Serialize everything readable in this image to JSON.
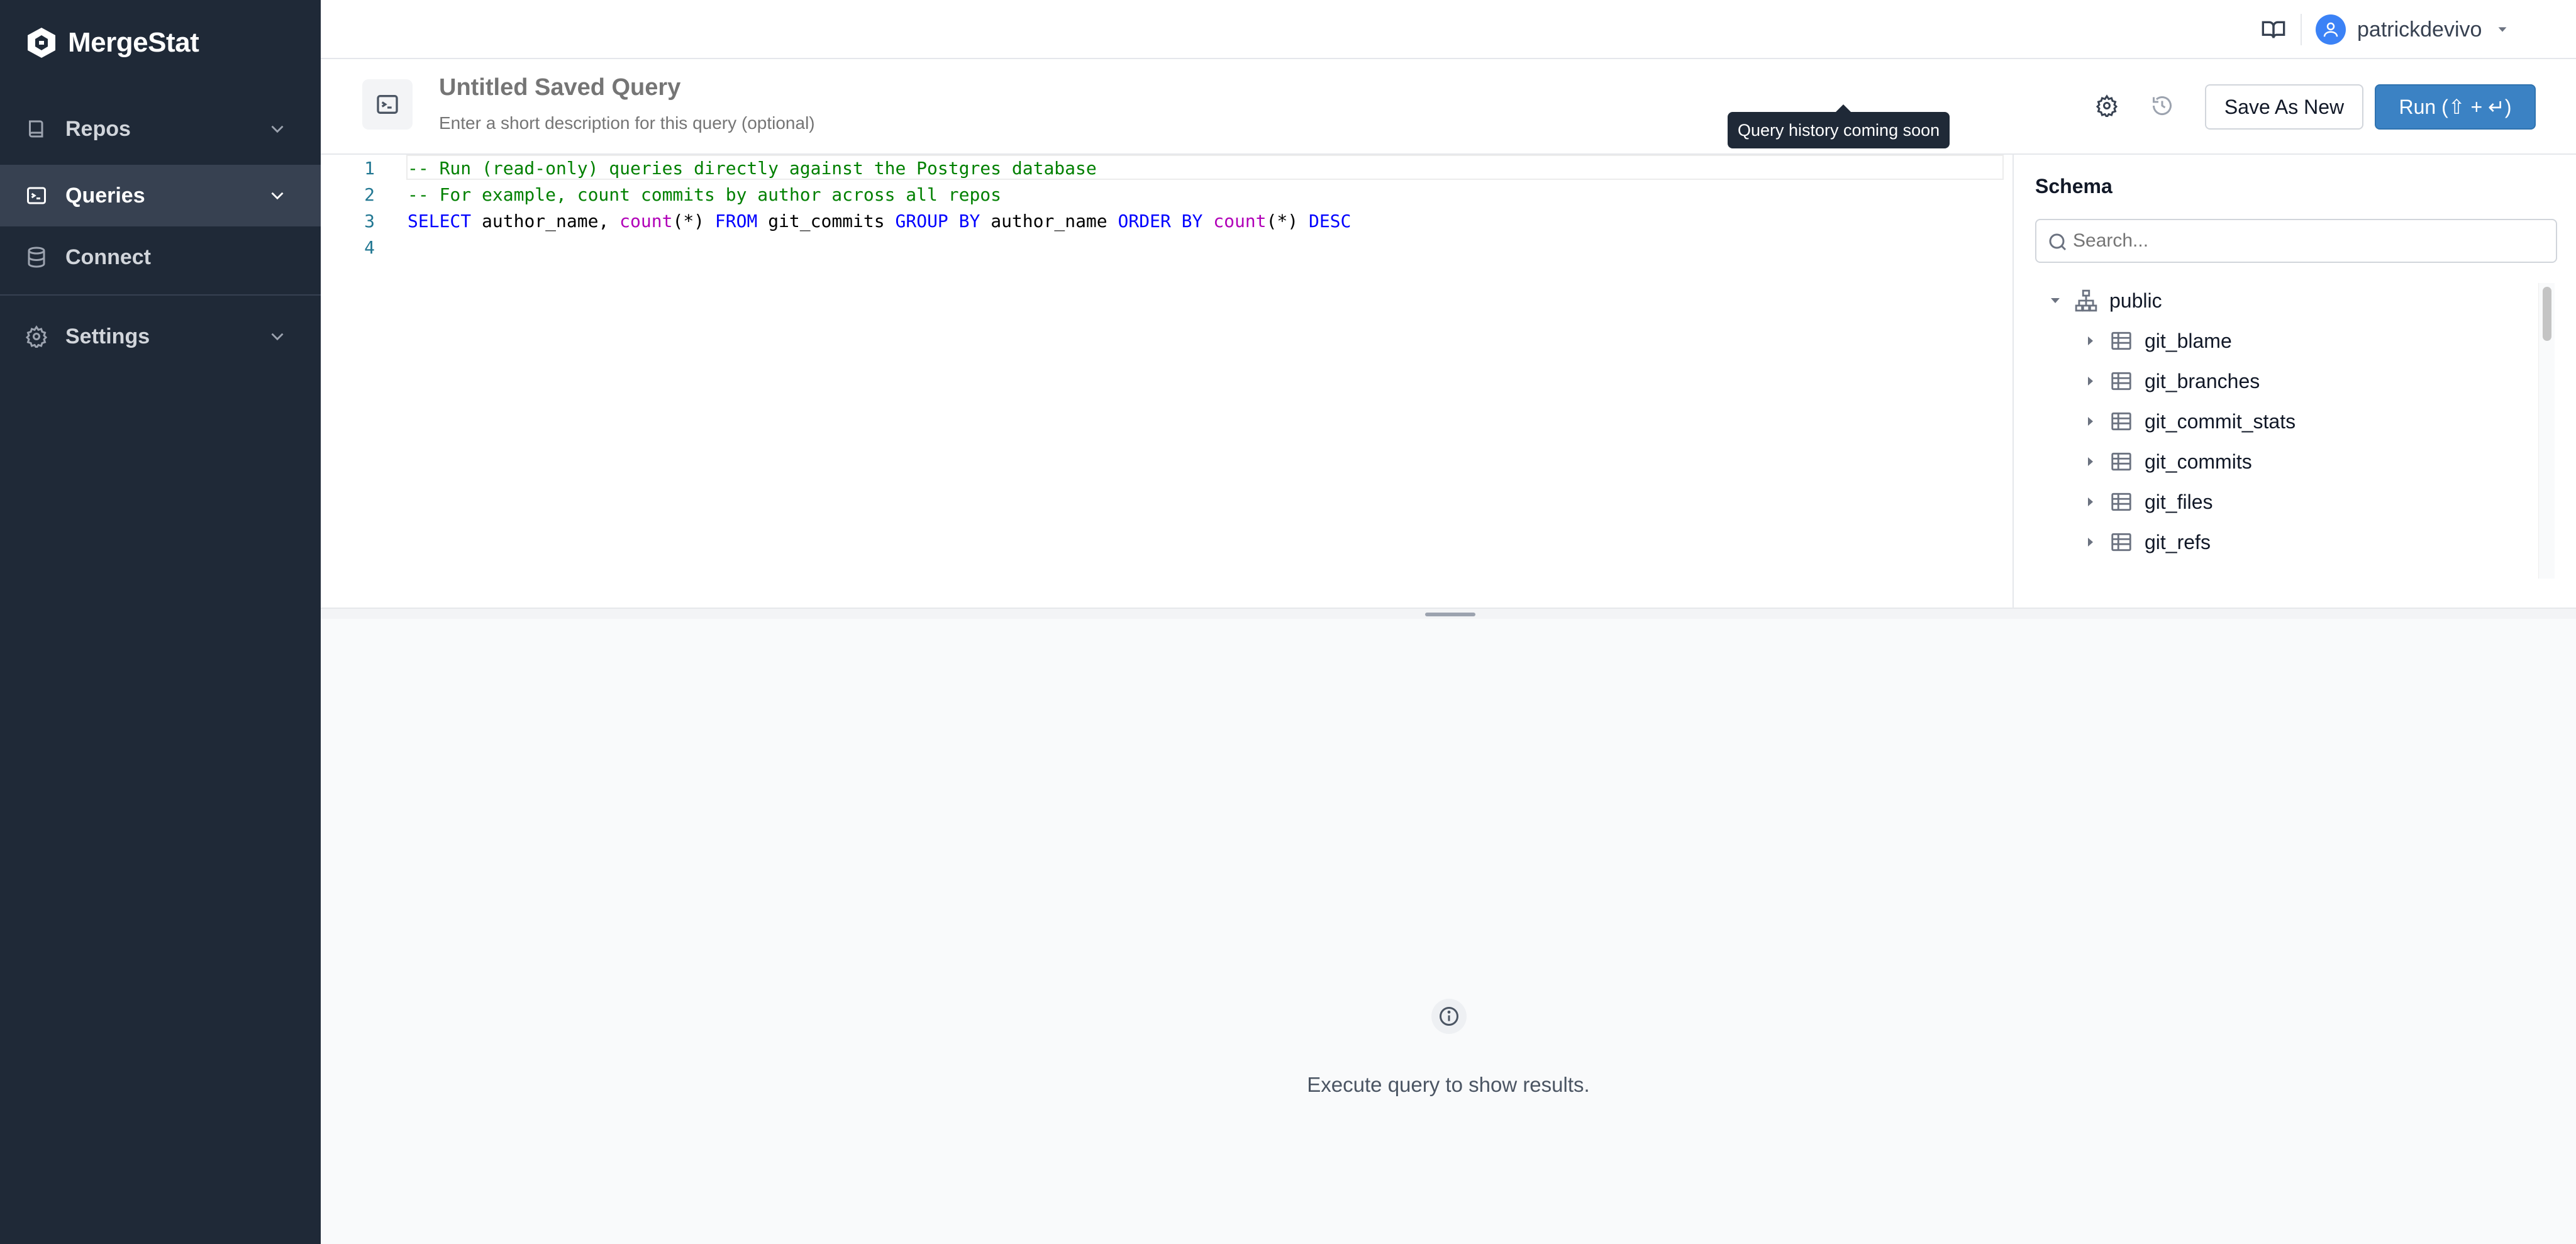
{
  "brand": {
    "name": "MergeStat"
  },
  "sidebar": {
    "items": [
      {
        "label": "Repos"
      },
      {
        "label": "Queries"
      },
      {
        "label": "Connect"
      },
      {
        "label": "Settings"
      }
    ]
  },
  "topbar": {
    "username": "patrickdevivo"
  },
  "query": {
    "title_placeholder": "Untitled Saved Query",
    "description_placeholder": "Enter a short description for this query (optional)"
  },
  "toolbar": {
    "save_label": "Save As New",
    "run_label": "Run (⇧ + ↵)",
    "history_tooltip": "Query history coming soon"
  },
  "editor": {
    "line_numbers": [
      "1",
      "2",
      "3",
      "4"
    ],
    "line1": "-- Run (read-only) queries directly against the Postgres database",
    "line2": "-- For example, count commits by author across all repos",
    "line3": {
      "t1": "SELECT",
      "t2": " author_name, ",
      "t3": "count",
      "t4": "(*) ",
      "t5": "FROM",
      "t6": " git_commits ",
      "t7": "GROUP BY",
      "t8": " author_name ",
      "t9": "ORDER BY",
      "t10": " ",
      "t11": "count",
      "t12": "(*) ",
      "t13": "DESC"
    }
  },
  "schema": {
    "title": "Schema",
    "search_placeholder": "Search...",
    "root": "public",
    "tables": [
      "git_blame",
      "git_branches",
      "git_commit_stats",
      "git_commits",
      "git_files",
      "git_refs"
    ]
  },
  "results": {
    "message": "Execute query to show results."
  },
  "colors": {
    "sidebar": "#1f2937",
    "sidebar_active": "#374151",
    "primary": "#3b82c4",
    "avatar": "#3b82f6"
  }
}
